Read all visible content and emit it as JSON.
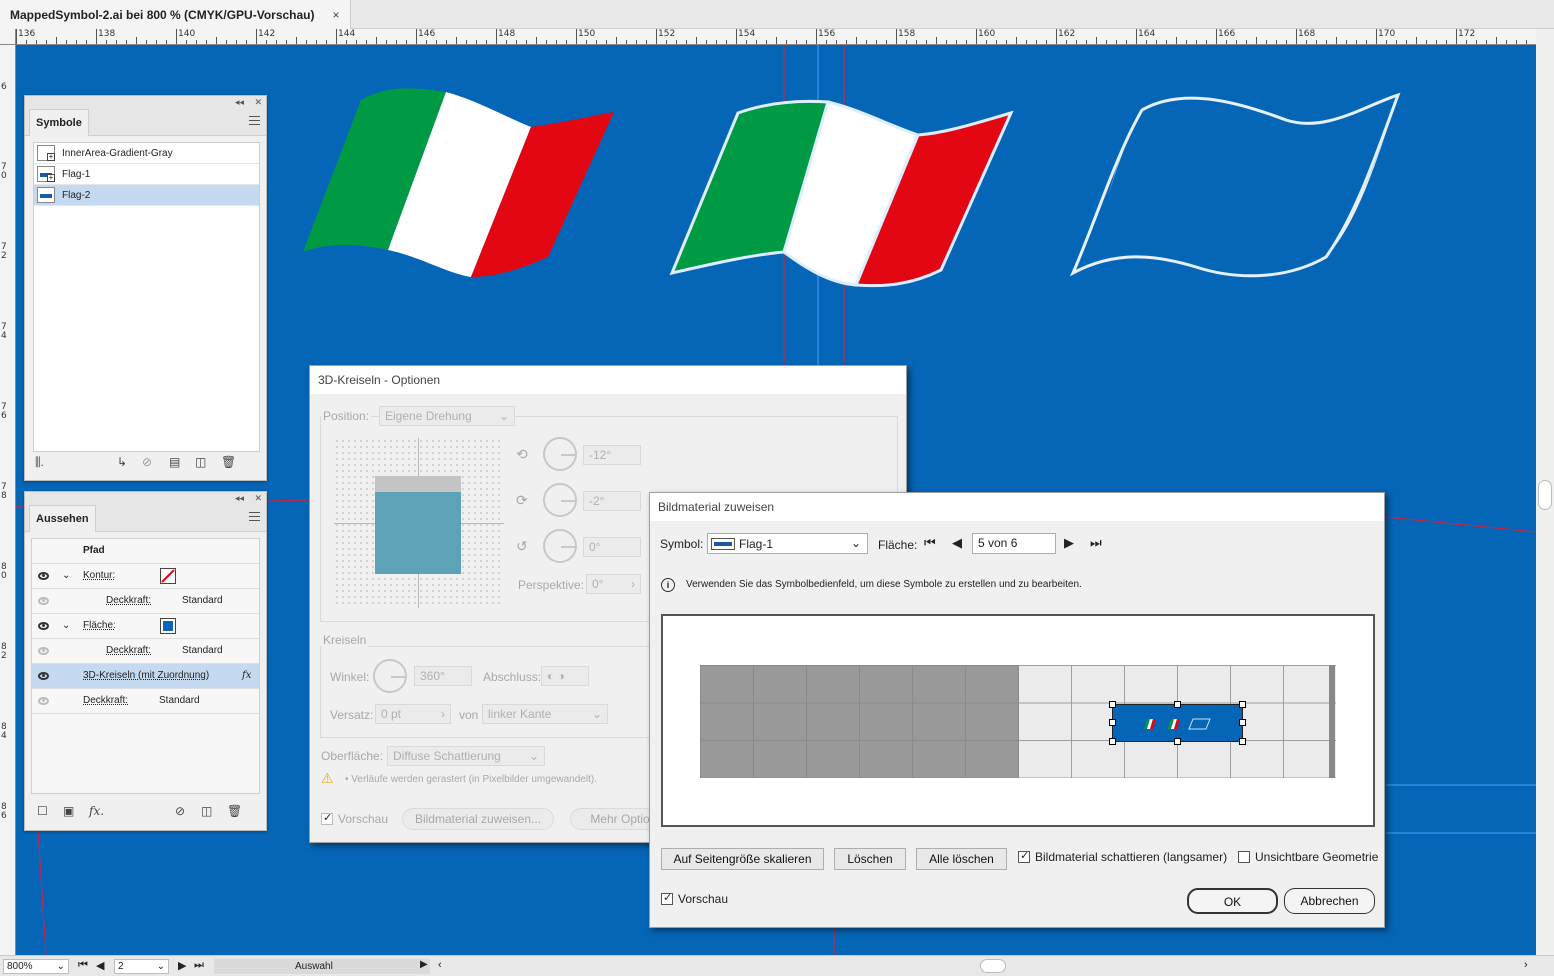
{
  "tab": {
    "title": "MappedSymbol-2.ai bei 800 % (CMYK/GPU-Vorschau)",
    "close": "×"
  },
  "ruler": {
    "h_labels": [
      "136",
      "138",
      "140",
      "142",
      "144",
      "146",
      "148",
      "150",
      "152",
      "154",
      "156",
      "158",
      "160",
      "162",
      "164",
      "166",
      "168",
      "170",
      "172"
    ],
    "v_labels": [
      "6",
      "7 0",
      "7 2",
      "7 4",
      "7 6",
      "7 8",
      "8 0",
      "8 2",
      "8 4",
      "8 6"
    ]
  },
  "symbols_panel": {
    "tab": "Symbole",
    "items": [
      {
        "name": "InnerArea-Gradient-Gray",
        "selected": false
      },
      {
        "name": "Flag-1",
        "selected": false
      },
      {
        "name": "Flag-2",
        "selected": true
      }
    ]
  },
  "appearance_panel": {
    "tab": "Aussehen",
    "header": "Pfad",
    "kontur_label": "Kontur:",
    "deckkraft_label": "Deckkraft:",
    "standard": "Standard",
    "flaeche_label": "Fläche:",
    "effect_label": "3D-Kreiseln (mit Zuordnung)",
    "fx": "fx",
    "fx_footer": "fx."
  },
  "dialog_3d": {
    "title": "3D-Kreiseln - Optionen",
    "position_label": "Position:",
    "position_value": "Eigene Drehung",
    "angle_x": "-12°",
    "angle_y": "-2°",
    "angle_z": "0°",
    "perspective_label": "Perspektive:",
    "perspective_value": "0°",
    "kreiseln_label": "Kreiseln",
    "winkel_label": "Winkel:",
    "winkel_value": "360°",
    "abschluss_label": "Abschluss:",
    "versatz_label": "Versatz:",
    "versatz_value": "0 pt",
    "von_label": "von",
    "von_value": "linker Kante",
    "oberflaeche_label": "Oberfläche:",
    "oberflaeche_value": "Diffuse Schattierung",
    "warning": "• Verläufe werden gerastert (in Pixelbilder umgewandelt).",
    "vorschau": "Vorschau",
    "map_button": "Bildmaterial zuweisen...",
    "more_button": "Mehr Optio"
  },
  "dialog_map": {
    "title": "Bildmaterial zuweisen",
    "symbol_label": "Symbol:",
    "symbol_value": "Flag-1",
    "flaeche_label": "Fläche:",
    "flaeche_value": "5 von 6",
    "info": "Verwenden Sie das Symbolbedienfeld, um diese Symbole zu erstellen und zu bearbeiten.",
    "btn_scale": "Auf Seitengröße skalieren",
    "btn_clear": "Löschen",
    "btn_clear_all": "Alle löschen",
    "shade_label": "Bildmaterial schattieren (langsamer)",
    "shade_checked": true,
    "invisible_label": "Unsichtbare Geometrie",
    "invisible_checked": false,
    "vorschau": "Vorschau",
    "vorschau_checked": true,
    "ok": "OK",
    "cancel": "Abbrechen"
  },
  "statusbar": {
    "zoom": "800%",
    "page": "2",
    "tool": "Auswahl"
  },
  "colors": {
    "canvas": "#0566b7",
    "green": "#009a44",
    "red": "#e30613",
    "white": "#ffffff",
    "guide": "#c2274b"
  }
}
